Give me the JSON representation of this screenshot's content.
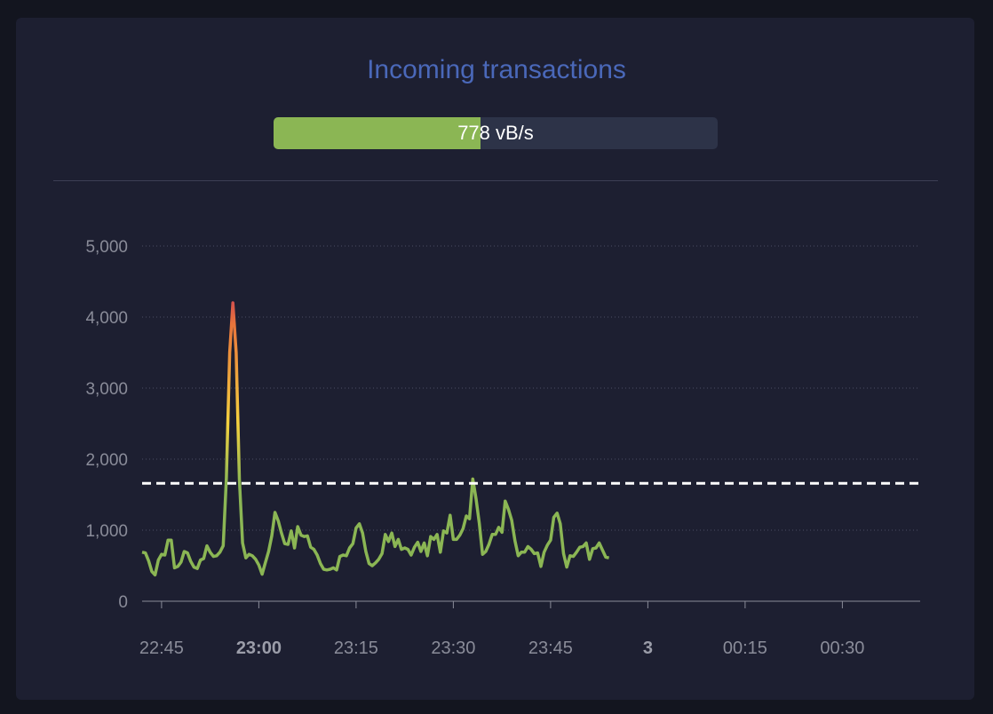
{
  "title": "Incoming transactions",
  "rate": {
    "label": "778 vB/s",
    "fraction": 0.466
  },
  "colors": {
    "base": "#8bb654",
    "mid": "#f5d23f",
    "high": "#e8743b",
    "peak": "#c2325e",
    "threshold": "#ffffff",
    "title": "#4a68b9"
  },
  "chart_data": {
    "type": "line",
    "title": "",
    "xlabel": "",
    "ylabel": "",
    "ylim": [
      0,
      5000
    ],
    "y_ticks": [
      "0",
      "1,000",
      "2,000",
      "3,000",
      "4,000",
      "5,000"
    ],
    "x_ticks": [
      {
        "label": "22:45",
        "minute": 3,
        "bold": false
      },
      {
        "label": "23:00",
        "minute": 18,
        "bold": true
      },
      {
        "label": "23:15",
        "minute": 33,
        "bold": false
      },
      {
        "label": "23:30",
        "minute": 48,
        "bold": false
      },
      {
        "label": "23:45",
        "minute": 63,
        "bold": false
      },
      {
        "label": "3",
        "minute": 78,
        "bold": true
      },
      {
        "label": "00:15",
        "minute": 93,
        "bold": false
      },
      {
        "label": "00:30",
        "minute": 108,
        "bold": false
      }
    ],
    "x_start": "22:42",
    "threshold": 1660,
    "grid": true,
    "series": [
      {
        "x_step_minutes": 0.5,
        "values": [
          690,
          680,
          570,
          420,
          370,
          580,
          660,
          650,
          860,
          860,
          470,
          490,
          550,
          700,
          680,
          560,
          480,
          460,
          580,
          600,
          780,
          690,
          630,
          640,
          690,
          780,
          1740,
          3500,
          4200,
          3500,
          1720,
          820,
          610,
          660,
          640,
          590,
          510,
          380,
          540,
          700,
          920,
          1250,
          1130,
          960,
          810,
          800,
          990,
          750,
          1050,
          930,
          910,
          920,
          760,
          730,
          650,
          530,
          450,
          440,
          450,
          470,
          440,
          630,
          650,
          640,
          750,
          810,
          1030,
          1090,
          960,
          700,
          530,
          500,
          540,
          590,
          670,
          940,
          840,
          960,
          770,
          870,
          730,
          750,
          730,
          650,
          760,
          830,
          700,
          820,
          640,
          910,
          870,
          940,
          690,
          990,
          960,
          1210,
          870,
          870,
          930,
          1020,
          1200,
          1160,
          1720,
          1440,
          1100,
          660,
          700,
          800,
          940,
          940,
          1040,
          970,
          1410,
          1290,
          1140,
          850,
          640,
          690,
          690,
          770,
          730,
          670,
          680,
          490,
          690,
          790,
          860,
          1180,
          1240,
          1090,
          670,
          480,
          640,
          630,
          690,
          760,
          770,
          820,
          590,
          740,
          750,
          820,
          720,
          620,
          610
        ]
      }
    ]
  }
}
